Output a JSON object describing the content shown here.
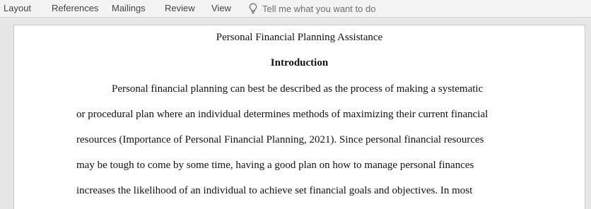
{
  "ribbon": {
    "tabs": [
      "Layout",
      "References",
      "Mailings",
      "Review",
      "View"
    ],
    "tell_me_placeholder": "Tell me what you want to do",
    "tell_me_icon": "lightbulb-icon"
  },
  "document": {
    "title": "Personal Financial Planning Assistance",
    "heading": "Introduction",
    "lines": [
      "Personal financial planning can best be described as the process of making a systematic",
      "or procedural plan where an individual determines methods of maximizing their current financial",
      "resources (Importance of Personal Financial Planning, 2021). Since personal financial resources",
      "may be tough to come by some time, having a good plan on how to manage personal finances",
      "increases the likelihood of an individual to achieve set financial goals and objectives. In most"
    ]
  }
}
